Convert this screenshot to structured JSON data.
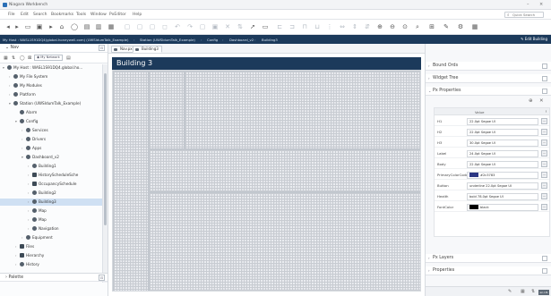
{
  "window": {
    "title": "Niagara Workbench",
    "controls": {
      "minimize": "–",
      "close": "×"
    }
  },
  "menu": {
    "items": [
      "File",
      "Edit",
      "Search",
      "Bookmarks",
      "Tools",
      "Window",
      "PxEditor",
      "Help"
    ],
    "quick_search_placeholder": "Quick Search"
  },
  "toolbar": {
    "icons": [
      "back-icon",
      "forward-icon",
      "up-level-icon",
      "folder-icon",
      "home-icon",
      "refresh-icon",
      "new-icon",
      "open-icon",
      "save-icon",
      "save-all-icon",
      "cut-icon",
      "copy-icon",
      "paste-icon",
      "undo-icon",
      "redo-icon",
      "delete-icon",
      "select-icon",
      "pan-icon",
      "draw-icon",
      "line-icon",
      "rectangle-icon",
      "align-icon",
      "distribute-icon",
      "zoom-in-icon",
      "zoom-out-icon",
      "zoom-fit-icon",
      "widget-icon",
      "grid-icon",
      "settings-icon",
      "layers-icon"
    ]
  },
  "locator": {
    "crumbs": [
      "My Host : WASL1S91DQ4(global.honeywell.com) (UWSIdumTalk_Example)",
      "Station (UWSIdumTalk_Example)",
      "Config",
      "Dashboard_v2",
      "Building3"
    ],
    "edit_label": "Edit Building"
  },
  "nav": {
    "title": "Nav",
    "select_value": "My Network",
    "tree": [
      {
        "indent": 0,
        "twisty": "▾",
        "label": "My Host : WASL1S91DQ4.global.ho...",
        "icon": "host-icon"
      },
      {
        "indent": 1,
        "twisty": "›",
        "label": "My File System",
        "icon": "file-system-icon"
      },
      {
        "indent": 1,
        "twisty": "›",
        "label": "My Modules",
        "icon": "modules-icon"
      },
      {
        "indent": 1,
        "twisty": "›",
        "label": "Platform",
        "icon": "platform-icon"
      },
      {
        "indent": 1,
        "twisty": "▾",
        "label": "Station (UWSIdumTalk_Example)",
        "icon": "station-icon"
      },
      {
        "indent": 2,
        "twisty": "",
        "label": "Alarm",
        "icon": "alarm-icon"
      },
      {
        "indent": 2,
        "twisty": "▾",
        "label": "Config",
        "icon": "config-icon"
      },
      {
        "indent": 3,
        "twisty": "›",
        "label": "Services",
        "icon": "services-icon"
      },
      {
        "indent": 3,
        "twisty": "›",
        "label": "Drivers",
        "icon": "drivers-icon"
      },
      {
        "indent": 3,
        "twisty": "›",
        "label": "Apps",
        "icon": "apps-icon"
      },
      {
        "indent": 3,
        "twisty": "▾",
        "label": "Dashboard_v2",
        "icon": "dashboard-icon"
      },
      {
        "indent": 4,
        "twisty": "›",
        "label": "Building1",
        "icon": "building-icon"
      },
      {
        "indent": 4,
        "twisty": "›",
        "label": "HistoryScheduleSche",
        "icon": "schedule-icon"
      },
      {
        "indent": 4,
        "twisty": "›",
        "label": "OccupancySchedule",
        "icon": "schedule-icon"
      },
      {
        "indent": 4,
        "twisty": "›",
        "label": "Building2",
        "icon": "building-icon"
      },
      {
        "indent": 4,
        "twisty": "›",
        "label": "Building3",
        "icon": "building-icon",
        "selected": true
      },
      {
        "indent": 4,
        "twisty": "›",
        "label": "Map",
        "icon": "map-icon"
      },
      {
        "indent": 4,
        "twisty": "›",
        "label": "Map",
        "icon": "map-icon"
      },
      {
        "indent": 4,
        "twisty": "›",
        "label": "Navigation",
        "icon": "navigation-icon"
      },
      {
        "indent": 3,
        "twisty": "›",
        "label": "Equipment",
        "icon": "equipment-icon"
      },
      {
        "indent": 2,
        "twisty": "›",
        "label": "Files",
        "icon": "files-icon"
      },
      {
        "indent": 2,
        "twisty": "›",
        "label": "Hierarchy",
        "icon": "hierarchy-icon"
      },
      {
        "indent": 2,
        "twisty": "›",
        "label": "History",
        "icon": "history-icon"
      }
    ]
  },
  "palette": {
    "title": "Palette"
  },
  "main": {
    "tabs": [
      {
        "label": "Nav.px",
        "active": false
      },
      {
        "label": "Building3",
        "active": true
      }
    ],
    "canvas_title": "Building 3"
  },
  "right": {
    "sections": {
      "bound_ords": "Bound Ords",
      "widget_tree": "Widget Tree",
      "px_properties": "Px Properties",
      "px_layers": "Px Layers",
      "properties": "Properties"
    },
    "prop_header": {
      "value": "Value"
    },
    "properties": [
      {
        "name": "H1",
        "value": "22.0pt Segoe UI"
      },
      {
        "name": "H2",
        "value": "22.0pt Segoe UI"
      },
      {
        "name": "H3",
        "value": "30.0pt Segoe UI"
      },
      {
        "name": "Label",
        "value": "24.0pt Segoe UI"
      },
      {
        "name": "Body",
        "value": "22.0pt Segoe UI"
      },
      {
        "name": "PrimaryColorCode",
        "value": "#2c3783",
        "swatch": "#2c3783"
      },
      {
        "name": "Button",
        "value": "underline 22.0pt Segoe UI"
      },
      {
        "name": "Health",
        "value": "bold 78.0pt Segoe UI"
      },
      {
        "name": "FontColor",
        "value": "black",
        "swatch": "#000000"
      }
    ]
  },
  "status": {
    "lang": "en-US"
  },
  "colors": {
    "locator_bg": "#1c3a5b",
    "selected_row": "#cfe0f3",
    "canvas_title_bg": "#1c3a5b"
  }
}
